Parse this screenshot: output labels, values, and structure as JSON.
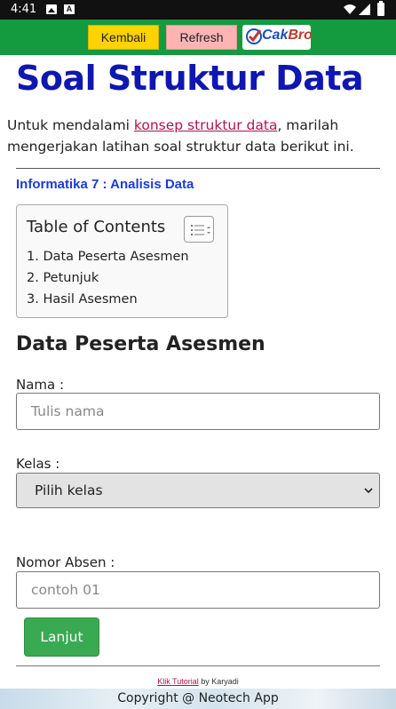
{
  "status_bar": {
    "time": "4:41",
    "icons": [
      "image-icon",
      "a-icon",
      "wifi-icon",
      "signal-icon",
      "battery-icon"
    ]
  },
  "toolbar": {
    "back_label": "Kembali",
    "refresh_label": "Refresh",
    "logo_text": "CakBro",
    "colors": {
      "background": "#149a3f",
      "back_button": "#ffd200",
      "refresh_button": "#ffb3b3"
    }
  },
  "page": {
    "title": "Soal Struktur Data",
    "intro_before": "Untuk mendalami ",
    "intro_link": "konsep struktur data",
    "intro_after": ", marilah mengerjakan latihan soal struktur data berikut ini.",
    "subtitle": "Informatika 7 : Analisis Data",
    "title_color": "#0f17b0"
  },
  "toc": {
    "title": "Table of Contents",
    "items": [
      {
        "label": "1. Data Peserta Asesmen"
      },
      {
        "label": "2. Petunjuk"
      },
      {
        "label": "3. Hasil Asesmen"
      }
    ]
  },
  "form": {
    "section_title": "Data Peserta Asesmen",
    "name_label": "Nama :",
    "name_placeholder": "Tulis nama",
    "class_label": "Kelas :",
    "class_selected": "Pilih kelas",
    "number_label": "Nomor Absen :",
    "number_placeholder": "contoh 01",
    "submit_label": "Lanjut"
  },
  "credit": {
    "link": "Klik Tutorial",
    "after": " by Karyadi"
  },
  "footer": {
    "text": "Copyright @ Neotech App"
  }
}
